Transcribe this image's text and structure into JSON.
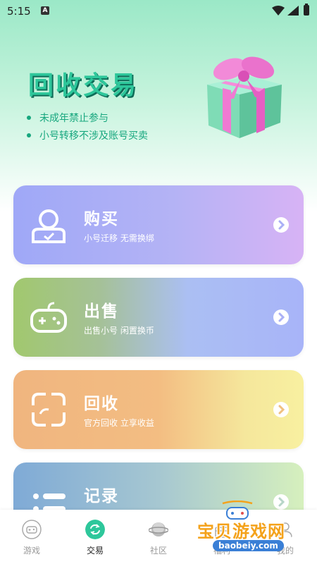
{
  "status_bar": {
    "time": "5:15",
    "notification_badge": "A"
  },
  "header": {
    "title": "回收交易",
    "notes": [
      "未成年禁止参与",
      "小号转移不涉及账号买卖"
    ],
    "gift_icon": "gift-box-icon"
  },
  "cards": [
    {
      "title": "购买",
      "subtitle": "小号迁移 无需换绑",
      "icon": "user-icon"
    },
    {
      "title": "出售",
      "subtitle": "出售小号 闲置换币",
      "icon": "gamepad-icon"
    },
    {
      "title": "回收",
      "subtitle": "官方回收 立享收益",
      "icon": "recycle-icon"
    },
    {
      "title": "记录",
      "subtitle": "",
      "icon": "list-icon"
    }
  ],
  "bottom_nav": [
    {
      "label": "游戏",
      "icon": "game-icon",
      "active": false
    },
    {
      "label": "交易",
      "icon": "exchange-icon",
      "active": true
    },
    {
      "label": "社区",
      "icon": "planet-icon",
      "active": false
    },
    {
      "label": "福利",
      "icon": "gift-icon",
      "active": false
    },
    {
      "label": "我的",
      "icon": "profile-icon",
      "active": false
    }
  ],
  "watermark": {
    "text": "宝贝游戏网",
    "url": "baobeiy.com"
  },
  "colors": {
    "accent": "#2ec79b",
    "note_text": "#17a77e"
  }
}
